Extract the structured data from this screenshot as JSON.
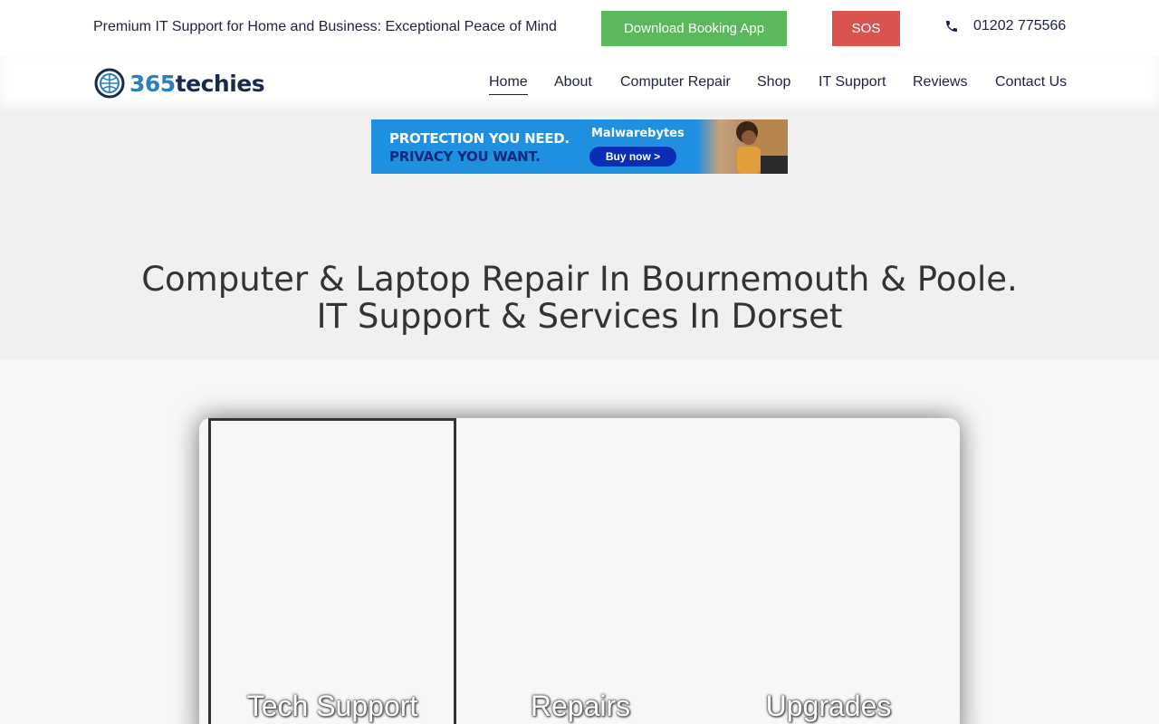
{
  "topbar": {
    "tagline": "Premium IT Support for Home and Business: Exceptional Peace of Mind",
    "download_label": "Download Booking App",
    "sos_label": "SOS",
    "phone": "01202 775566"
  },
  "logo": {
    "number": "365",
    "word": "techies"
  },
  "nav": {
    "items": [
      "Home",
      "About",
      "Computer Repair",
      "Shop",
      "IT Support",
      "Reviews",
      "Contact Us"
    ],
    "active": "Home"
  },
  "ad": {
    "line1": "PROTECTION YOU NEED.",
    "line2": "PRIVACY YOU WANT.",
    "brand": "Malwarebytes",
    "cta": "Buy now >"
  },
  "hero": {
    "line1": "Computer & Laptop Repair In Bournemouth & Poole.",
    "line2": "IT Support & Services In Dorset"
  },
  "cards": [
    "Tech Support",
    "Repairs",
    "Upgrades"
  ],
  "colors": {
    "green": "#5cb85c",
    "red": "#d9534f",
    "navy": "#1e2240",
    "brand_blue": "#2a7fc1",
    "ad_blue": "#1f8fe0"
  }
}
